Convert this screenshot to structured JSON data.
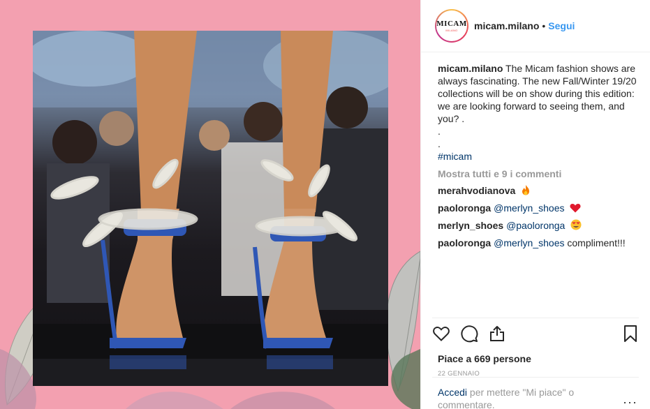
{
  "post": {
    "username": "micam.milano",
    "separator": "•",
    "follow_label": "Segui",
    "avatar_text": "MICAM",
    "avatar_subtext": "MILANO",
    "caption_username": "micam.milano",
    "caption_lines": [
      "The Micam fashion shows are always fascinating. The new Fall/Winter 19/20 collections will be on show during this edition: we are looking forward to seeing them, and you? .",
      ".",
      "."
    ],
    "hashtag": "#micam",
    "load_more_label": "Mostra tutti e 9 i commenti",
    "comments": [
      {
        "user": "merahvodianova",
        "mention": "",
        "text": "",
        "emoji": "fire"
      },
      {
        "user": "paoloronga",
        "mention": "@merlyn_shoes",
        "text": "",
        "emoji": "red-heart"
      },
      {
        "user": "merlyn_shoes",
        "mention": "@paoloronga",
        "text": "",
        "emoji": "heart-eyes"
      },
      {
        "user": "paoloronga",
        "mention": "@merlyn_shoes",
        "text": "compliment!!!",
        "emoji": ""
      }
    ],
    "likes_label": "Piace a 669 persone",
    "date_label": "22 GENNAIO",
    "login_link": "Accedi",
    "login_text": " per mettere \"Mi piace\" o commentare.",
    "more_options": "···"
  },
  "colors": {
    "background_pink": "#f3a0b0",
    "link_blue": "#3897f0",
    "mention_blue": "#003569",
    "muted_gray": "#999999"
  }
}
